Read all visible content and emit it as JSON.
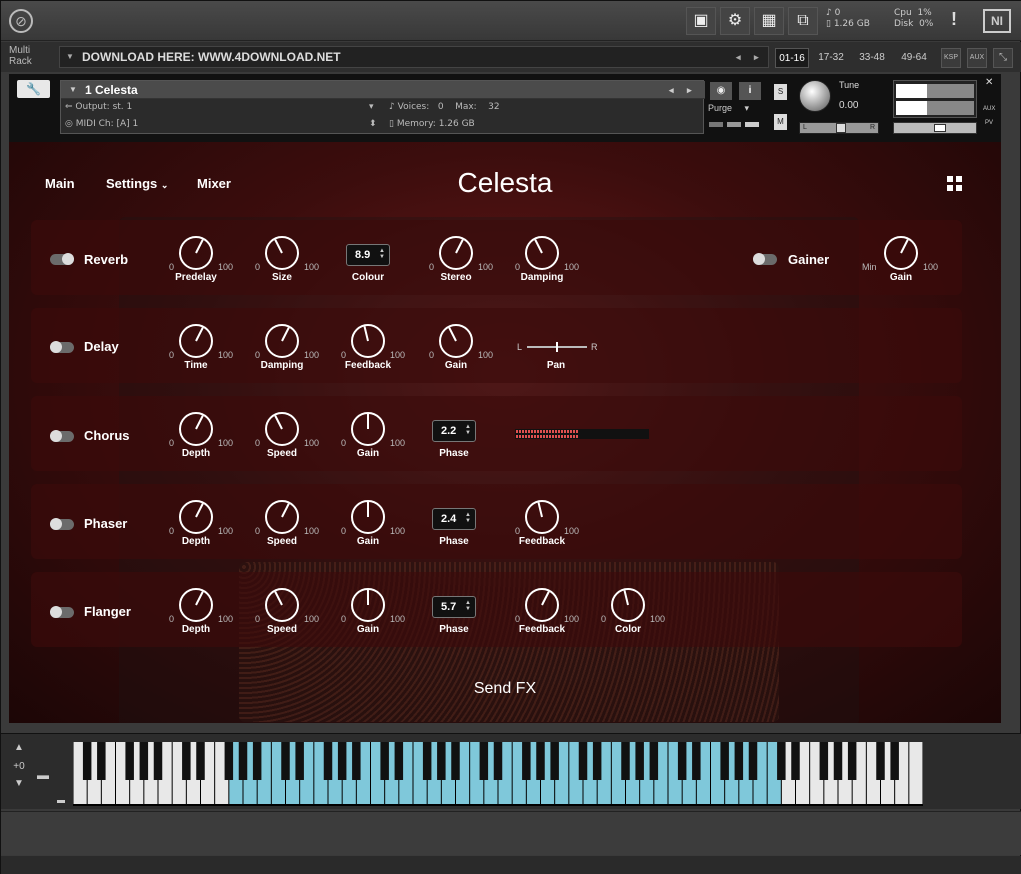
{
  "topbar": {
    "voices": "0",
    "memory": "1.26 GB",
    "cpu_label": "Cpu",
    "cpu_value": "1%",
    "disk_label": "Disk",
    "disk_value": "0%",
    "alert": "!",
    "logo": "NI"
  },
  "rackbar": {
    "multirack_line1": "Multi",
    "multirack_line2": "Rack",
    "preset_name": "DOWNLOAD HERE: WWW.4DOWNLOAD.NET",
    "page_tabs": [
      "01-16",
      "17-32",
      "33-48",
      "49-64"
    ],
    "active_tab": "01-16",
    "ksp": "KSP",
    "aux": "AUX"
  },
  "instrument": {
    "name": "1 Celesta",
    "output_label": "Output:",
    "output_value": "st. 1",
    "voices_label": "Voices:",
    "voices_value": "0",
    "max_label": "Max:",
    "max_value": "32",
    "midi_label": "MIDI Ch:",
    "midi_value": "[A]  1",
    "memory_label": "Memory:",
    "memory_value": "1.26 GB",
    "purge": "Purge",
    "solo": "S",
    "mute": "M",
    "tune_label": "Tune",
    "tune_value": "0.00",
    "pan_left": "L",
    "pan_right": "R",
    "aux_label": "AUX",
    "pv_label": "PV"
  },
  "nav": {
    "main": "Main",
    "settings": "Settings",
    "mixer": "Mixer",
    "title": "Celesta"
  },
  "sections": {
    "reverb": {
      "name": "Reverb",
      "enabled": true,
      "knobs": [
        {
          "label": "Predelay",
          "min": "0",
          "max": "100",
          "value": 0.6
        },
        {
          "label": "Size",
          "min": "0",
          "max": "100",
          "value": 0.4
        },
        {
          "label": "Stereo",
          "min": "0",
          "max": "100",
          "value": 0.6
        },
        {
          "label": "Damping",
          "min": "0",
          "max": "100",
          "value": 0.4
        }
      ],
      "colour": {
        "label": "Colour",
        "value": "8.9"
      }
    },
    "gainer": {
      "name": "Gainer",
      "enabled": false,
      "knob": {
        "label": "Gain",
        "min": "Min",
        "max": "100",
        "value": 0.6
      }
    },
    "delay": {
      "name": "Delay",
      "enabled": false,
      "knobs": [
        {
          "label": "Time",
          "min": "0",
          "max": "100",
          "value": 0.6
        },
        {
          "label": "Damping",
          "min": "0",
          "max": "100",
          "value": 0.6
        },
        {
          "label": "Feedback",
          "min": "0",
          "max": "100",
          "value": 0.45
        },
        {
          "label": "Gain",
          "min": "0",
          "max": "100",
          "value": 0.4
        }
      ],
      "pan": {
        "label": "Pan",
        "left": "L",
        "right": "R",
        "value": 0.5
      }
    },
    "chorus": {
      "name": "Chorus",
      "enabled": false,
      "knobs": [
        {
          "label": "Depth",
          "min": "0",
          "max": "100",
          "value": 0.6
        },
        {
          "label": "Speed",
          "min": "0",
          "max": "100",
          "value": 0.4
        },
        {
          "label": "Gain",
          "min": "0",
          "max": "100",
          "value": 0.5
        }
      ],
      "phase": {
        "label": "Phase",
        "value": "2.2"
      }
    },
    "phaser": {
      "name": "Phaser",
      "enabled": false,
      "knobs": [
        {
          "label": "Depth",
          "min": "0",
          "max": "100",
          "value": 0.6
        },
        {
          "label": "Speed",
          "min": "0",
          "max": "100",
          "value": 0.6
        },
        {
          "label": "Gain",
          "min": "0",
          "max": "100",
          "value": 0.5
        },
        {
          "label": "Feedback",
          "min": "0",
          "max": "100",
          "value": 0.45
        }
      ],
      "phase": {
        "label": "Phase",
        "value": "2.4"
      }
    },
    "flanger": {
      "name": "Flanger",
      "enabled": false,
      "knobs": [
        {
          "label": "Depth",
          "min": "0",
          "max": "100",
          "value": 0.6
        },
        {
          "label": "Speed",
          "min": "0",
          "max": "100",
          "value": 0.4
        },
        {
          "label": "Gain",
          "min": "0",
          "max": "100",
          "value": 0.5
        },
        {
          "label": "Feedback",
          "min": "0",
          "max": "100",
          "value": 0.6
        },
        {
          "label": "Color",
          "min": "0",
          "max": "100",
          "value": 0.45
        }
      ],
      "phase": {
        "label": "Phase",
        "value": "5.7"
      }
    }
  },
  "send_fx": "Send FX",
  "keyboard": {
    "octave_offset": "+0",
    "highlight_color": "#7fc8da"
  },
  "colors": {
    "panel_bg": "#3c0d0d",
    "section_bg": "#3c0a0a",
    "meter_color": "#e05050"
  }
}
